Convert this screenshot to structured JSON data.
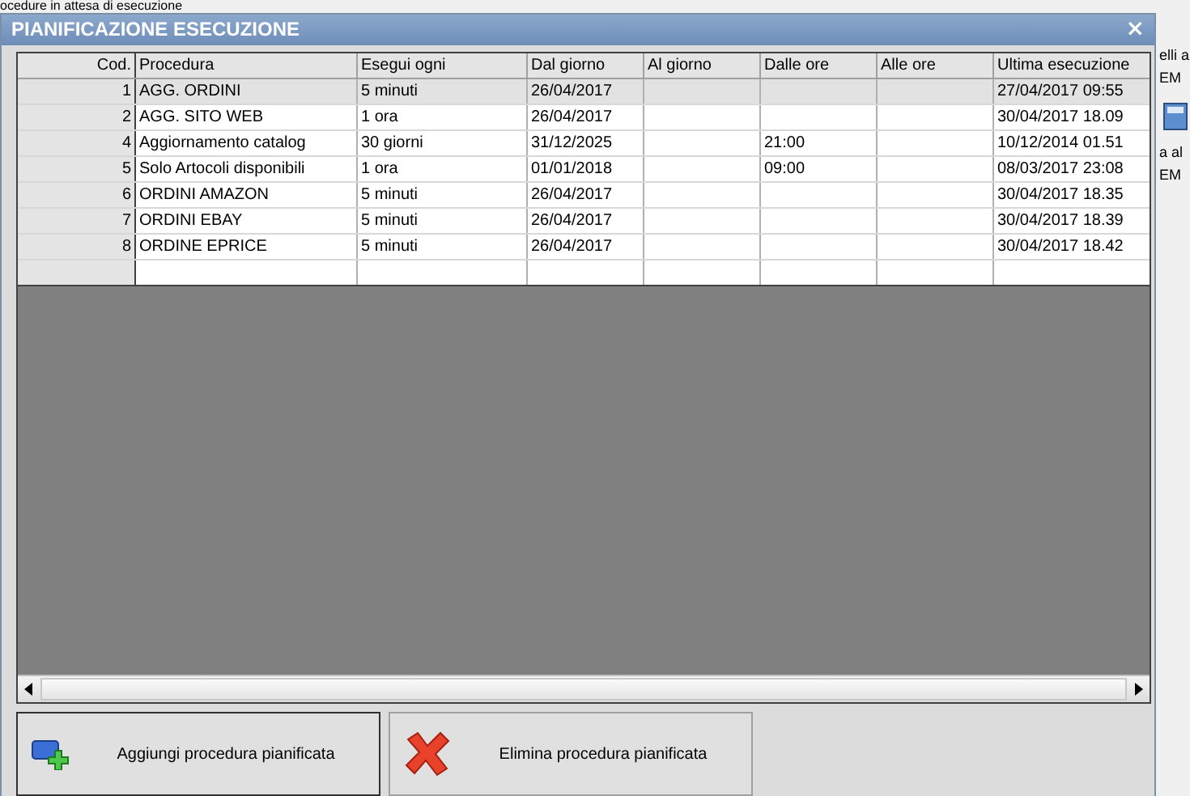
{
  "background": {
    "top_text": "ocedure in attesa di esecuzione",
    "side_texts": [
      "elli a",
      "EM",
      "a al",
      "EM"
    ]
  },
  "window": {
    "title": "PIANIFICAZIONE ESECUZIONE",
    "close": "×"
  },
  "table": {
    "columns": [
      "Cod.",
      "Procedura",
      "Esegui ogni",
      "Dal giorno",
      "Al giorno",
      "Dalle ore",
      "Alle ore",
      "Ultima esecuzione"
    ],
    "rows": [
      {
        "cells": [
          "1",
          "AGG. ORDINI",
          "5 minuti",
          "26/04/2017",
          "",
          "",
          "",
          "27/04/2017 09:55"
        ],
        "selected": true
      },
      {
        "cells": [
          "2",
          "AGG. SITO WEB",
          "1 ora",
          "26/04/2017",
          "",
          "",
          "",
          "30/04/2017 18.09"
        ],
        "selected": false
      },
      {
        "cells": [
          "4",
          "Aggiornamento catalog",
          "30 giorni",
          "31/12/2025",
          "",
          "21:00",
          "",
          "10/12/2014 01.51"
        ],
        "selected": false
      },
      {
        "cells": [
          "5",
          "Solo Artocoli disponibili",
          "1 ora",
          "01/01/2018",
          "",
          "09:00",
          "",
          "08/03/2017 23:08"
        ],
        "selected": false
      },
      {
        "cells": [
          "6",
          "ORDINI AMAZON",
          "5 minuti",
          "26/04/2017",
          "",
          "",
          "",
          "30/04/2017 18.35"
        ],
        "selected": false
      },
      {
        "cells": [
          "7",
          "ORDINI EBAY",
          "5 minuti",
          "26/04/2017",
          "",
          "",
          "",
          "30/04/2017 18.39"
        ],
        "selected": false
      },
      {
        "cells": [
          "8",
          "ORDINE EPRICE",
          "5 minuti",
          "26/04/2017",
          "",
          "",
          "",
          "30/04/2017 18.42"
        ],
        "selected": false
      }
    ]
  },
  "buttons": [
    {
      "label": "Aggiungi procedura pianificata",
      "kind": "add"
    },
    {
      "label": "Elimina procedura pianificata",
      "kind": "delete"
    }
  ]
}
